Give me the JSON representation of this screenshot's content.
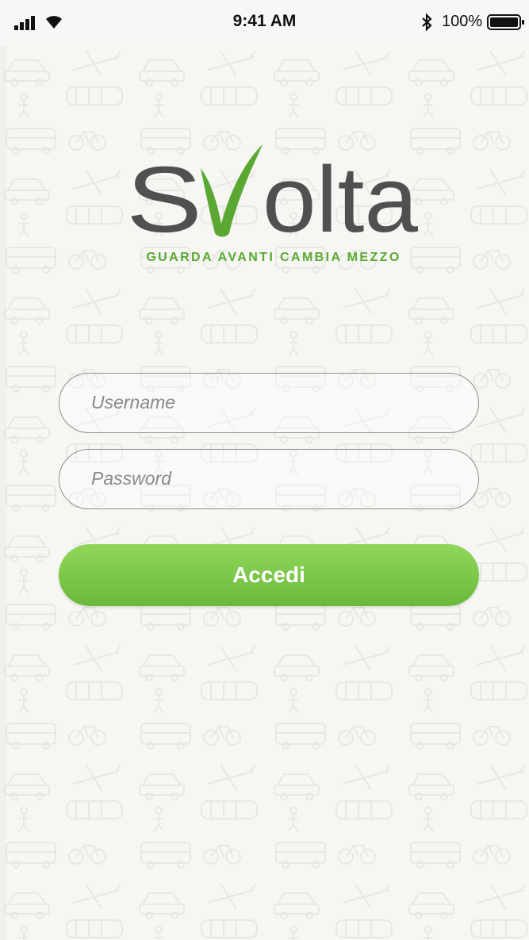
{
  "status_bar": {
    "time": "9:41 AM",
    "battery_percent": "100%",
    "icons": [
      "signal-icon",
      "wifi-icon",
      "bluetooth-icon",
      "battery-icon"
    ]
  },
  "logo": {
    "text": "SVolta",
    "tagline": "GUARDA AVANTI CAMBIA MEZZO",
    "colors": {
      "text": "#505050",
      "accent": "#5aa831"
    }
  },
  "login_form": {
    "username": {
      "placeholder": "Username",
      "value": ""
    },
    "password": {
      "placeholder": "Password",
      "value": ""
    },
    "submit_label": "Accedi"
  },
  "colors": {
    "background": "#f6f6f3",
    "button": "#7cc84a",
    "field_border": "#8f8f8f"
  }
}
